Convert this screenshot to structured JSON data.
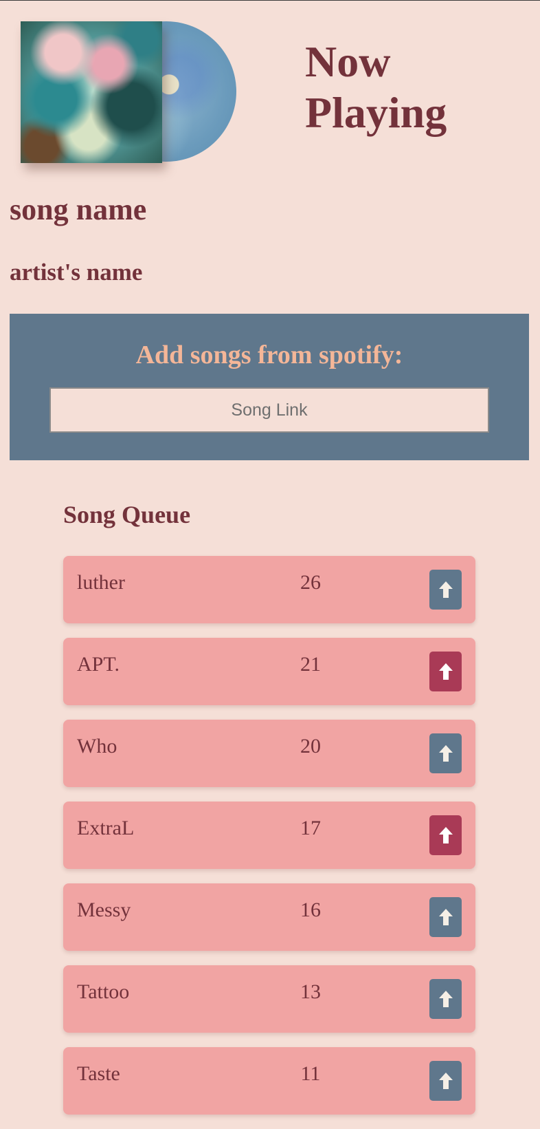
{
  "header": {
    "title": "Now Playing"
  },
  "now_playing": {
    "song_name": "song name",
    "artist_name": "artist's name"
  },
  "add_songs": {
    "title": "Add songs from spotify:",
    "input_placeholder": "Song Link",
    "input_value": ""
  },
  "queue": {
    "title": "Song Queue",
    "items": [
      {
        "title": "luther",
        "votes": "26",
        "voted": false
      },
      {
        "title": "APT.",
        "votes": "21",
        "voted": true
      },
      {
        "title": "Who",
        "votes": "20",
        "voted": false
      },
      {
        "title": "ExtraL",
        "votes": "17",
        "voted": true
      },
      {
        "title": "Messy",
        "votes": "16",
        "voted": false
      },
      {
        "title": "Tattoo",
        "votes": "13",
        "voted": false
      },
      {
        "title": "Taste",
        "votes": "11",
        "voted": false
      }
    ]
  },
  "icons": {
    "upvote": "arrow-up-icon"
  },
  "colors": {
    "background": "#f5dfd7",
    "text": "#73323b",
    "panel": "#5f778c",
    "panel_title": "#f4b698",
    "queue_item": "#f1a4a3",
    "upvote_default": "#5f778c",
    "upvote_voted": "#a93a56"
  }
}
